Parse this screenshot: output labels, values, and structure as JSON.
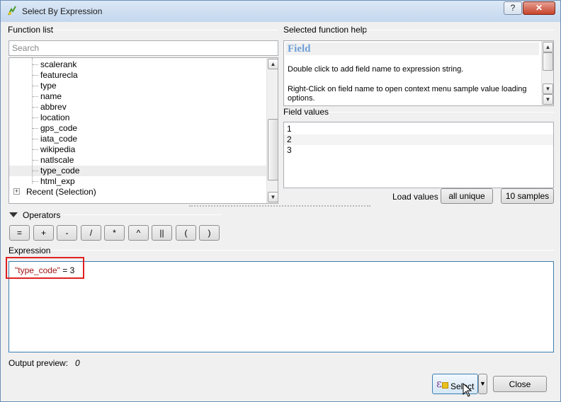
{
  "window": {
    "title": "Select By Expression",
    "help_label": "?",
    "close_label": "✕"
  },
  "function_list": {
    "label": "Function list",
    "search_placeholder": "Search",
    "fields": [
      "scalerank",
      "featurecla",
      "type",
      "name",
      "abbrev",
      "location",
      "gps_code",
      "iata_code",
      "wikipedia",
      "natlscale",
      "type_code",
      "html_exp"
    ],
    "selected_field": "type_code",
    "recent_group": "Recent (Selection)",
    "expander_glyph": "+"
  },
  "help": {
    "label": "Selected function help",
    "title": "Field",
    "line1": "Double click to add field name to expression string.",
    "line2": "Right-Click on field name to open context menu sample value loading options."
  },
  "field_values": {
    "label": "Field values",
    "values": [
      "1",
      "2",
      "3"
    ],
    "load_label": "Load values",
    "all_unique_label": "all unique",
    "samples_label": "10 samples"
  },
  "operators": {
    "label": "Operators",
    "buttons": [
      "=",
      "+",
      "-",
      "/",
      "*",
      "^",
      "||",
      "(",
      ")"
    ]
  },
  "expression": {
    "label": "Expression",
    "field": "\"type_code\"",
    "rest": " = 3"
  },
  "output": {
    "label": "Output preview:",
    "value": "0"
  },
  "footer": {
    "select_label": "Select",
    "close_label": "Close",
    "dropdown_glyph": "▼"
  },
  "colors": {
    "highlight": "#e02020",
    "field_token": "#a31515",
    "help_title": "#6f9fd8"
  }
}
